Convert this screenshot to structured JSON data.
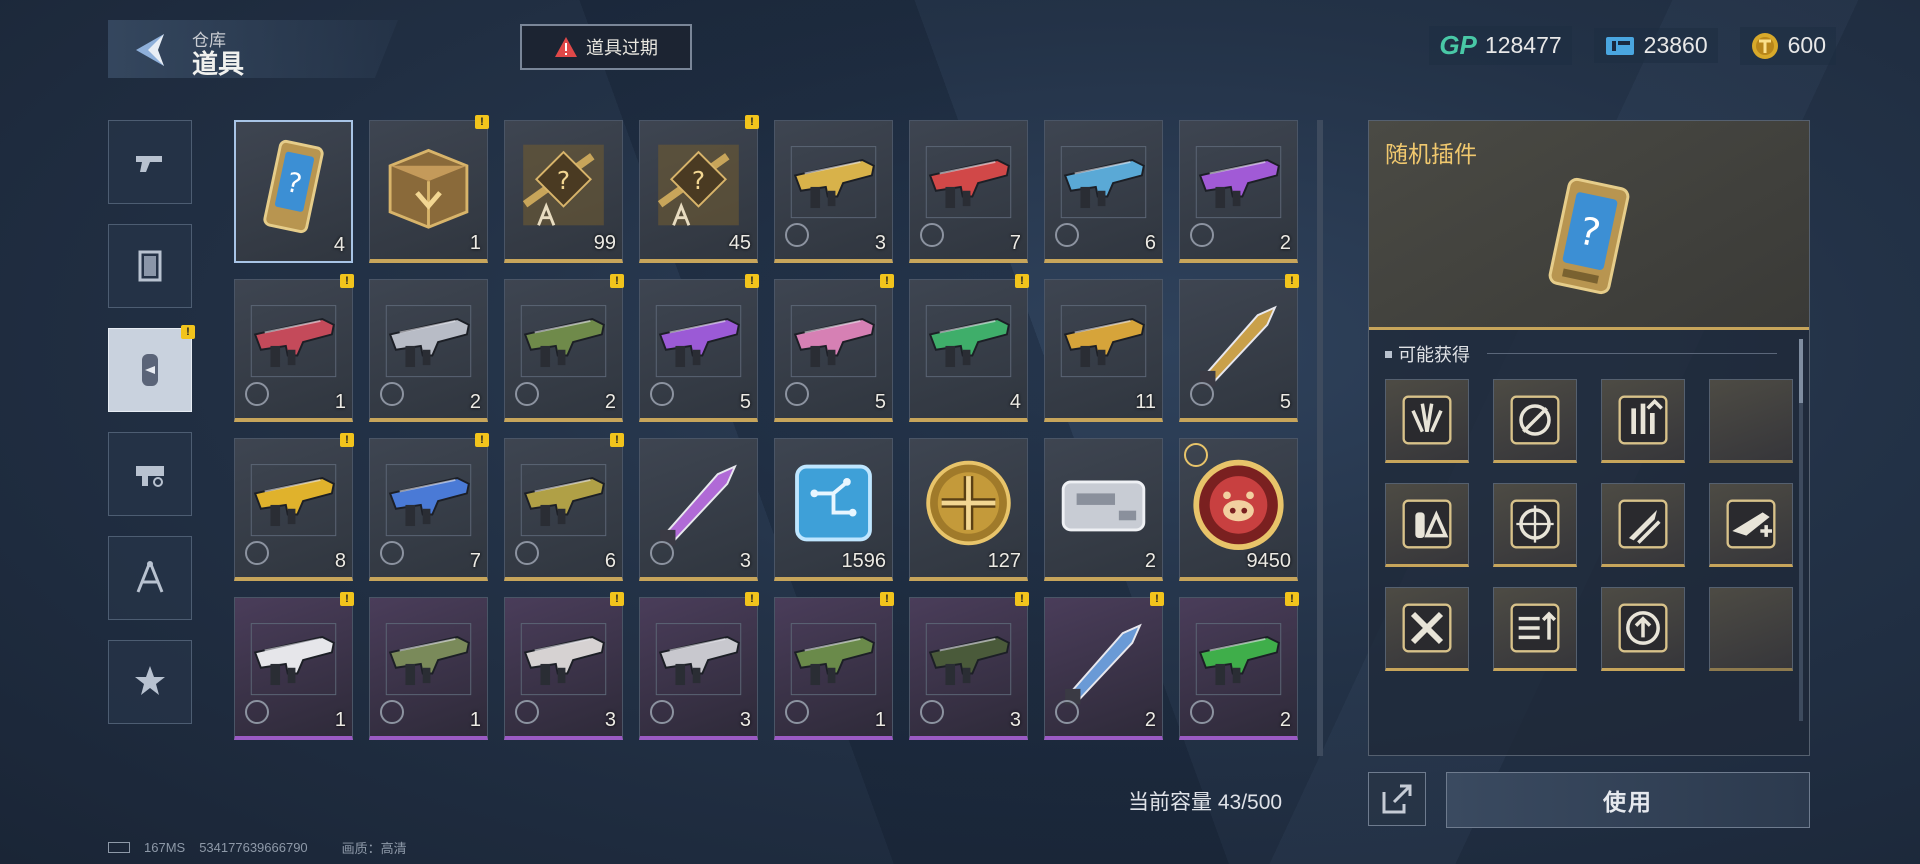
{
  "header": {
    "breadcrumb": "仓库",
    "title": "道具",
    "alert_label": "道具过期"
  },
  "currencies": [
    {
      "icon": "gp-icon",
      "label": "GP",
      "value": "128477"
    },
    {
      "icon": "ticket-icon",
      "value": "23860"
    },
    {
      "icon": "gold-coin-icon",
      "value": "600"
    }
  ],
  "nav": [
    {
      "name": "nav-weapons",
      "icon": "pistol-icon",
      "active": false,
      "badge": false
    },
    {
      "name": "nav-cards",
      "icon": "card-icon",
      "active": false,
      "badge": false
    },
    {
      "name": "nav-items",
      "icon": "capsule-icon",
      "active": true,
      "badge": true
    },
    {
      "name": "nav-attachments",
      "icon": "attachment-icon",
      "active": false,
      "badge": false
    },
    {
      "name": "nav-blueprints",
      "icon": "compass-icon",
      "active": false,
      "badge": false
    },
    {
      "name": "nav-favorites",
      "icon": "star-icon",
      "active": false,
      "badge": false
    }
  ],
  "items": [
    {
      "count": "4",
      "kind": "card",
      "rarity": "gold",
      "selected": true,
      "badge": false,
      "clock": false
    },
    {
      "count": "1",
      "kind": "box",
      "rarity": "gold",
      "badge": true,
      "clock": false
    },
    {
      "count": "99",
      "kind": "blueprint",
      "rarity": "gold",
      "badge": false,
      "clock": false
    },
    {
      "count": "45",
      "kind": "blueprint",
      "rarity": "gold",
      "badge": true,
      "clock": false
    },
    {
      "count": "3",
      "kind": "gun",
      "rarity": "gold",
      "badge": false,
      "clock": true,
      "accent": "#d8b24a"
    },
    {
      "count": "7",
      "kind": "gun",
      "rarity": "gold",
      "badge": false,
      "clock": true,
      "accent": "#d14848"
    },
    {
      "count": "6",
      "kind": "gun",
      "rarity": "gold",
      "badge": false,
      "clock": true,
      "accent": "#5aa9d6"
    },
    {
      "count": "2",
      "kind": "gun",
      "rarity": "gold",
      "badge": false,
      "clock": true,
      "accent": "#a15ad6"
    },
    {
      "count": "1",
      "kind": "gun",
      "rarity": "gold",
      "badge": true,
      "clock": true,
      "accent": "#c44a5a"
    },
    {
      "count": "2",
      "kind": "gun",
      "rarity": "gold",
      "badge": false,
      "clock": true,
      "accent": "#b8bcc6"
    },
    {
      "count": "2",
      "kind": "gun",
      "rarity": "gold",
      "badge": true,
      "clock": true,
      "accent": "#6f8a4a"
    },
    {
      "count": "5",
      "kind": "gun",
      "rarity": "gold",
      "badge": true,
      "clock": true,
      "accent": "#9b5ad6"
    },
    {
      "count": "5",
      "kind": "gun",
      "rarity": "gold",
      "badge": true,
      "clock": true,
      "accent": "#d680b4"
    },
    {
      "count": "4",
      "kind": "gun",
      "rarity": "gold",
      "badge": true,
      "clock": false,
      "accent": "#3fae6a"
    },
    {
      "count": "11",
      "kind": "gun",
      "rarity": "gold",
      "badge": false,
      "clock": false,
      "accent": "#d6a43a"
    },
    {
      "count": "5",
      "kind": "blade",
      "rarity": "gold",
      "badge": true,
      "clock": true,
      "accent": "#c9a04a"
    },
    {
      "count": "8",
      "kind": "gun",
      "rarity": "gold",
      "badge": true,
      "clock": true,
      "accent": "#e0b22c"
    },
    {
      "count": "7",
      "kind": "gun",
      "rarity": "gold",
      "badge": true,
      "clock": true,
      "accent": "#4a7ad6"
    },
    {
      "count": "6",
      "kind": "gun",
      "rarity": "gold",
      "badge": true,
      "clock": true,
      "accent": "#b0a046"
    },
    {
      "count": "3",
      "kind": "blade",
      "rarity": "gold",
      "badge": false,
      "clock": true,
      "accent": "#b06ad6"
    },
    {
      "count": "1596",
      "kind": "chip",
      "rarity": "gold",
      "badge": false,
      "clock": false
    },
    {
      "count": "127",
      "kind": "coin",
      "rarity": "gold",
      "badge": false,
      "clock": false
    },
    {
      "count": "2",
      "kind": "device",
      "rarity": "gold",
      "badge": false,
      "clock": false
    },
    {
      "count": "9450",
      "kind": "pig-coin",
      "rarity": "gold",
      "badge": false,
      "clock": false,
      "timed": true
    },
    {
      "count": "1",
      "kind": "gun",
      "rarity": "purple",
      "badge": true,
      "clock": true,
      "accent": "#e6e6ea"
    },
    {
      "count": "1",
      "kind": "gun",
      "rarity": "purple",
      "badge": false,
      "clock": true,
      "accent": "#7a8a5a"
    },
    {
      "count": "3",
      "kind": "gun",
      "rarity": "purple",
      "badge": true,
      "clock": true,
      "accent": "#d6d2d2"
    },
    {
      "count": "3",
      "kind": "gun",
      "rarity": "purple",
      "badge": true,
      "clock": true,
      "accent": "#c8c8ce"
    },
    {
      "count": "1",
      "kind": "gun",
      "rarity": "purple",
      "badge": true,
      "clock": true,
      "accent": "#6a8a4a"
    },
    {
      "count": "3",
      "kind": "gun",
      "rarity": "purple",
      "badge": true,
      "clock": true,
      "accent": "#4a5a3a"
    },
    {
      "count": "2",
      "kind": "blade",
      "rarity": "purple",
      "badge": true,
      "clock": true,
      "accent": "#6a9ad6"
    },
    {
      "count": "2",
      "kind": "gun",
      "rarity": "purple",
      "badge": true,
      "clock": true,
      "accent": "#3fae4a"
    }
  ],
  "capacity": "当前容量 43/500",
  "footer": {
    "ping": "167MS",
    "uid": "534177639666790",
    "quality": "画质：高清"
  },
  "detail": {
    "title": "随机插件",
    "section_label": "可能获得",
    "rewards": [
      {
        "icon": "muzzle-icon"
      },
      {
        "icon": "no-scope-icon"
      },
      {
        "icon": "grip-up-icon"
      },
      {
        "icon": ""
      },
      {
        "icon": "ammo-warning-icon"
      },
      {
        "icon": "crosshair-icon"
      },
      {
        "icon": "bullet-icon"
      },
      {
        "icon": "rifle-plus-icon"
      },
      {
        "icon": "cross-arrows-icon"
      },
      {
        "icon": "list-up-icon"
      },
      {
        "icon": "circle-up-icon"
      },
      {
        "icon": ""
      }
    ],
    "use_label": "使用"
  },
  "colors": {
    "gold": "#c7a55b",
    "purple": "#9b5bc4",
    "badge": "#f2c41c",
    "gp": "#49c8a6",
    "title_gold": "#f0c86e"
  }
}
